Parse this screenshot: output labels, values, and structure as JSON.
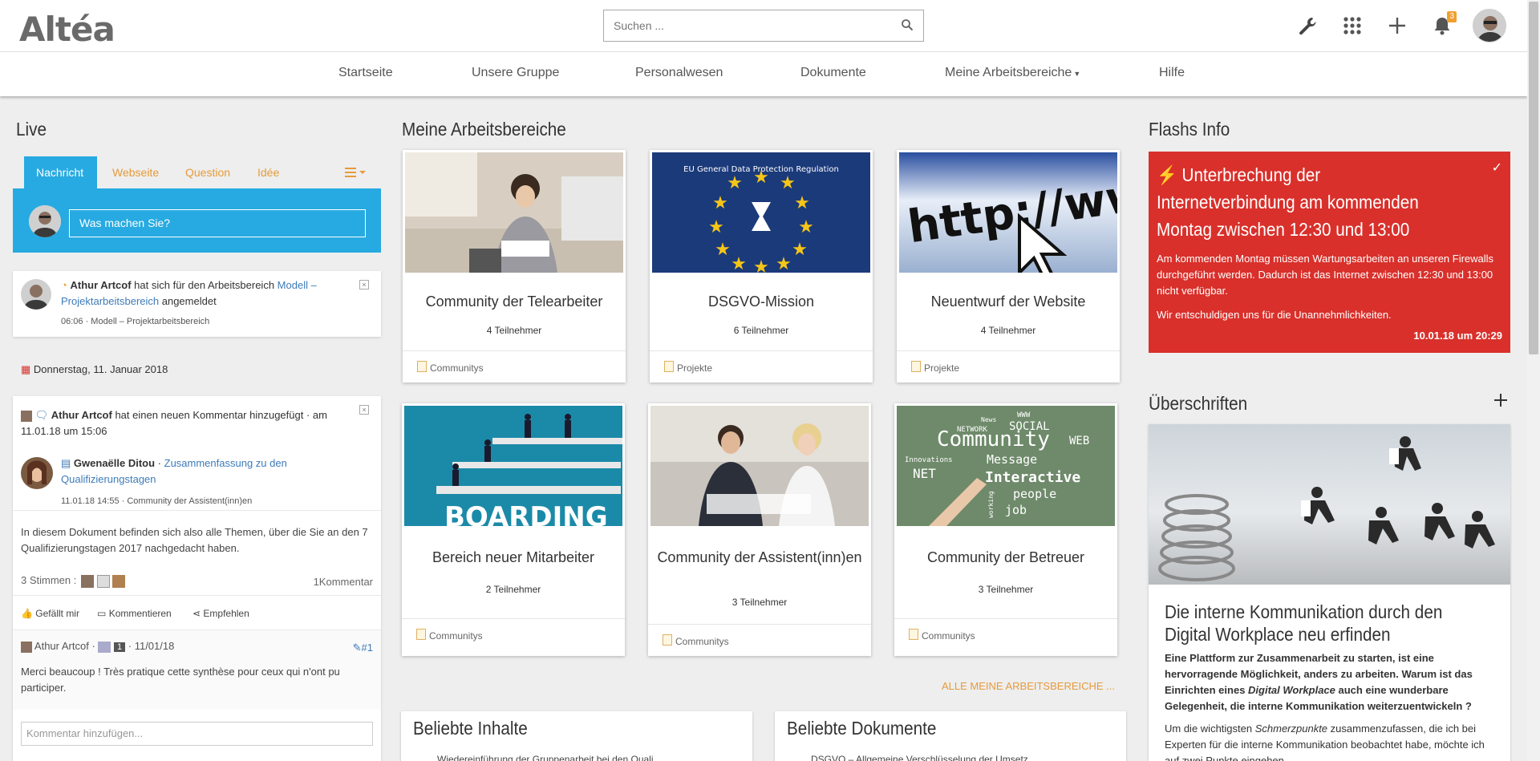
{
  "header": {
    "logo": "Altéa",
    "search_placeholder": "Suchen ...",
    "notification_count": "3"
  },
  "nav": {
    "items": [
      {
        "label": "Startseite"
      },
      {
        "label": "Unsere Gruppe"
      },
      {
        "label": "Personalwesen"
      },
      {
        "label": "Dokumente"
      },
      {
        "label": "Meine Arbeitsbereiche"
      },
      {
        "label": "Hilfe"
      }
    ]
  },
  "live": {
    "title": "Live",
    "tabs": [
      "Nachricht",
      "Webseite",
      "Question",
      "Idée"
    ],
    "post_placeholder": "Was machen Sie?",
    "activity1": {
      "author": "Athur Artcof",
      "text": " hat sich für den Arbeitsbereich ",
      "link": "Modell – Projektarbeitsbereich",
      "suffix": " angemeldet",
      "meta": "06:06 · Modell – Projektarbeitsbereich"
    },
    "date_separator": "Donnerstag, 11. Januar 2018",
    "activity2": {
      "author": "Athur Artcof",
      "text": " hat einen neuen Kommentar hinzugefügt · am 11.01.18 um 15:06",
      "doc_author": "Gwenaëlle Ditou",
      "doc_link": "Zusammenfassung zu den Qualifizierungstagen",
      "doc_meta": "11.01.18 14:55 · Community der Assistent(inn)en",
      "body": "In diesem Dokument befinden sich also alle Themen, über die Sie an den 7 Qualifizierungstagen   2017 nachgedacht haben.",
      "votes": "3 Stimmen :",
      "comments_count": "1Kommentar",
      "like": "Gefällt mir",
      "comment": "Kommentieren",
      "recommend": "Empfehlen",
      "comment_author": "Athur Artcof",
      "comment_number": "1",
      "comment_date": "11/01/18",
      "comment_ref": "#1",
      "comment_text": "Merci beaucoup ! Très pratique cette synthèse pour ceux qui n'ont pu participer.",
      "add_comment_placeholder": "Kommentar hinzufügen..."
    }
  },
  "workspaces": {
    "title": "Meine Arbeitsbereiche",
    "items": [
      {
        "title": "Community der Telearbeiter",
        "members": "4 Teilnehmer",
        "category": "Communitys"
      },
      {
        "title": "DSGVO-Mission",
        "members": "6 Teilnehmer",
        "category": "Projekte"
      },
      {
        "title": "Neuentwurf der Website",
        "members": "4 Teilnehmer",
        "category": "Projekte"
      },
      {
        "title": "Bereich neuer Mitarbeiter",
        "members": "2 Teilnehmer",
        "category": "Communitys"
      },
      {
        "title": "Community der Assistent(inn)en",
        "members": "3 Teilnehmer",
        "category": "Communitys"
      },
      {
        "title": "Community der Betreuer",
        "members": "3 Teilnehmer",
        "category": "Communitys"
      }
    ],
    "all_link": "ALLE MEINE ARBEITSBEREICHE ...",
    "img_texts": {
      "gdpr": "EU General Data Protection Regulation",
      "http": "http://www",
      "boarding": "BOARDING",
      "community": "Community",
      "c1": "NETWORK",
      "c2": "SOCIAL",
      "c3": "WEB",
      "c4": "Message",
      "c5": "Interactive",
      "c6": "people",
      "c7": "job",
      "c8": "NET",
      "c9": "News",
      "c10": "WWW",
      "c11": "Innovations",
      "c12": "working"
    }
  },
  "popular": {
    "content_title": "Beliebte Inhalte",
    "content_first": "Wiedereinführung der Gruppenarbeit bei den Quali...",
    "docs_title": "Beliebte Dokumente",
    "docs_first": "DSGVO – Allgemeine Verschlüsselung der Umsetz..."
  },
  "flash": {
    "title": "Flashs Info",
    "headline": "Unterbrechung der Internetverbindung am kommenden Montag zwischen 12:30 und 13:00",
    "body1": "Am kommenden Montag müssen Wartungsarbeiten an unseren Firewalls durchgeführt werden. Dadurch ist das Internet zwischen 12:30 und 13:00 nicht verfügbar.",
    "body2": "Wir entschuldigen uns für die Unannehmlichkeiten.",
    "date": "10.01.18 um 20:29"
  },
  "headlines": {
    "title": "Überschriften",
    "article_title": "Die interne Kommunikation durch den Digital Workplace neu erfinden",
    "lead_part1": "Eine Plattform zur Zusammenarbeit zu starten, ist eine hervorragende Möglichkeit, anders zu arbeiten. Warum ist das Einrichten eines ",
    "lead_em": "Digital Workplace",
    "lead_part2": "  auch eine wunderbare Gelegenheit, die interne Kommunikation weiterzuentwickeln ?",
    "body_part1": "Um die wichtigsten ",
    "body_em": "Schmerzpunkte",
    "body_part2": "  zusammenzufassen, die ich bei Experten für die interne Kommunikation beobachtet habe, möchte ich auf zwei Punkte eingehen"
  },
  "colors": {
    "accent": "#27aae1",
    "tab_text": "#e79a3a",
    "flash_bg": "#d9302b",
    "link": "#3e7bb8"
  }
}
